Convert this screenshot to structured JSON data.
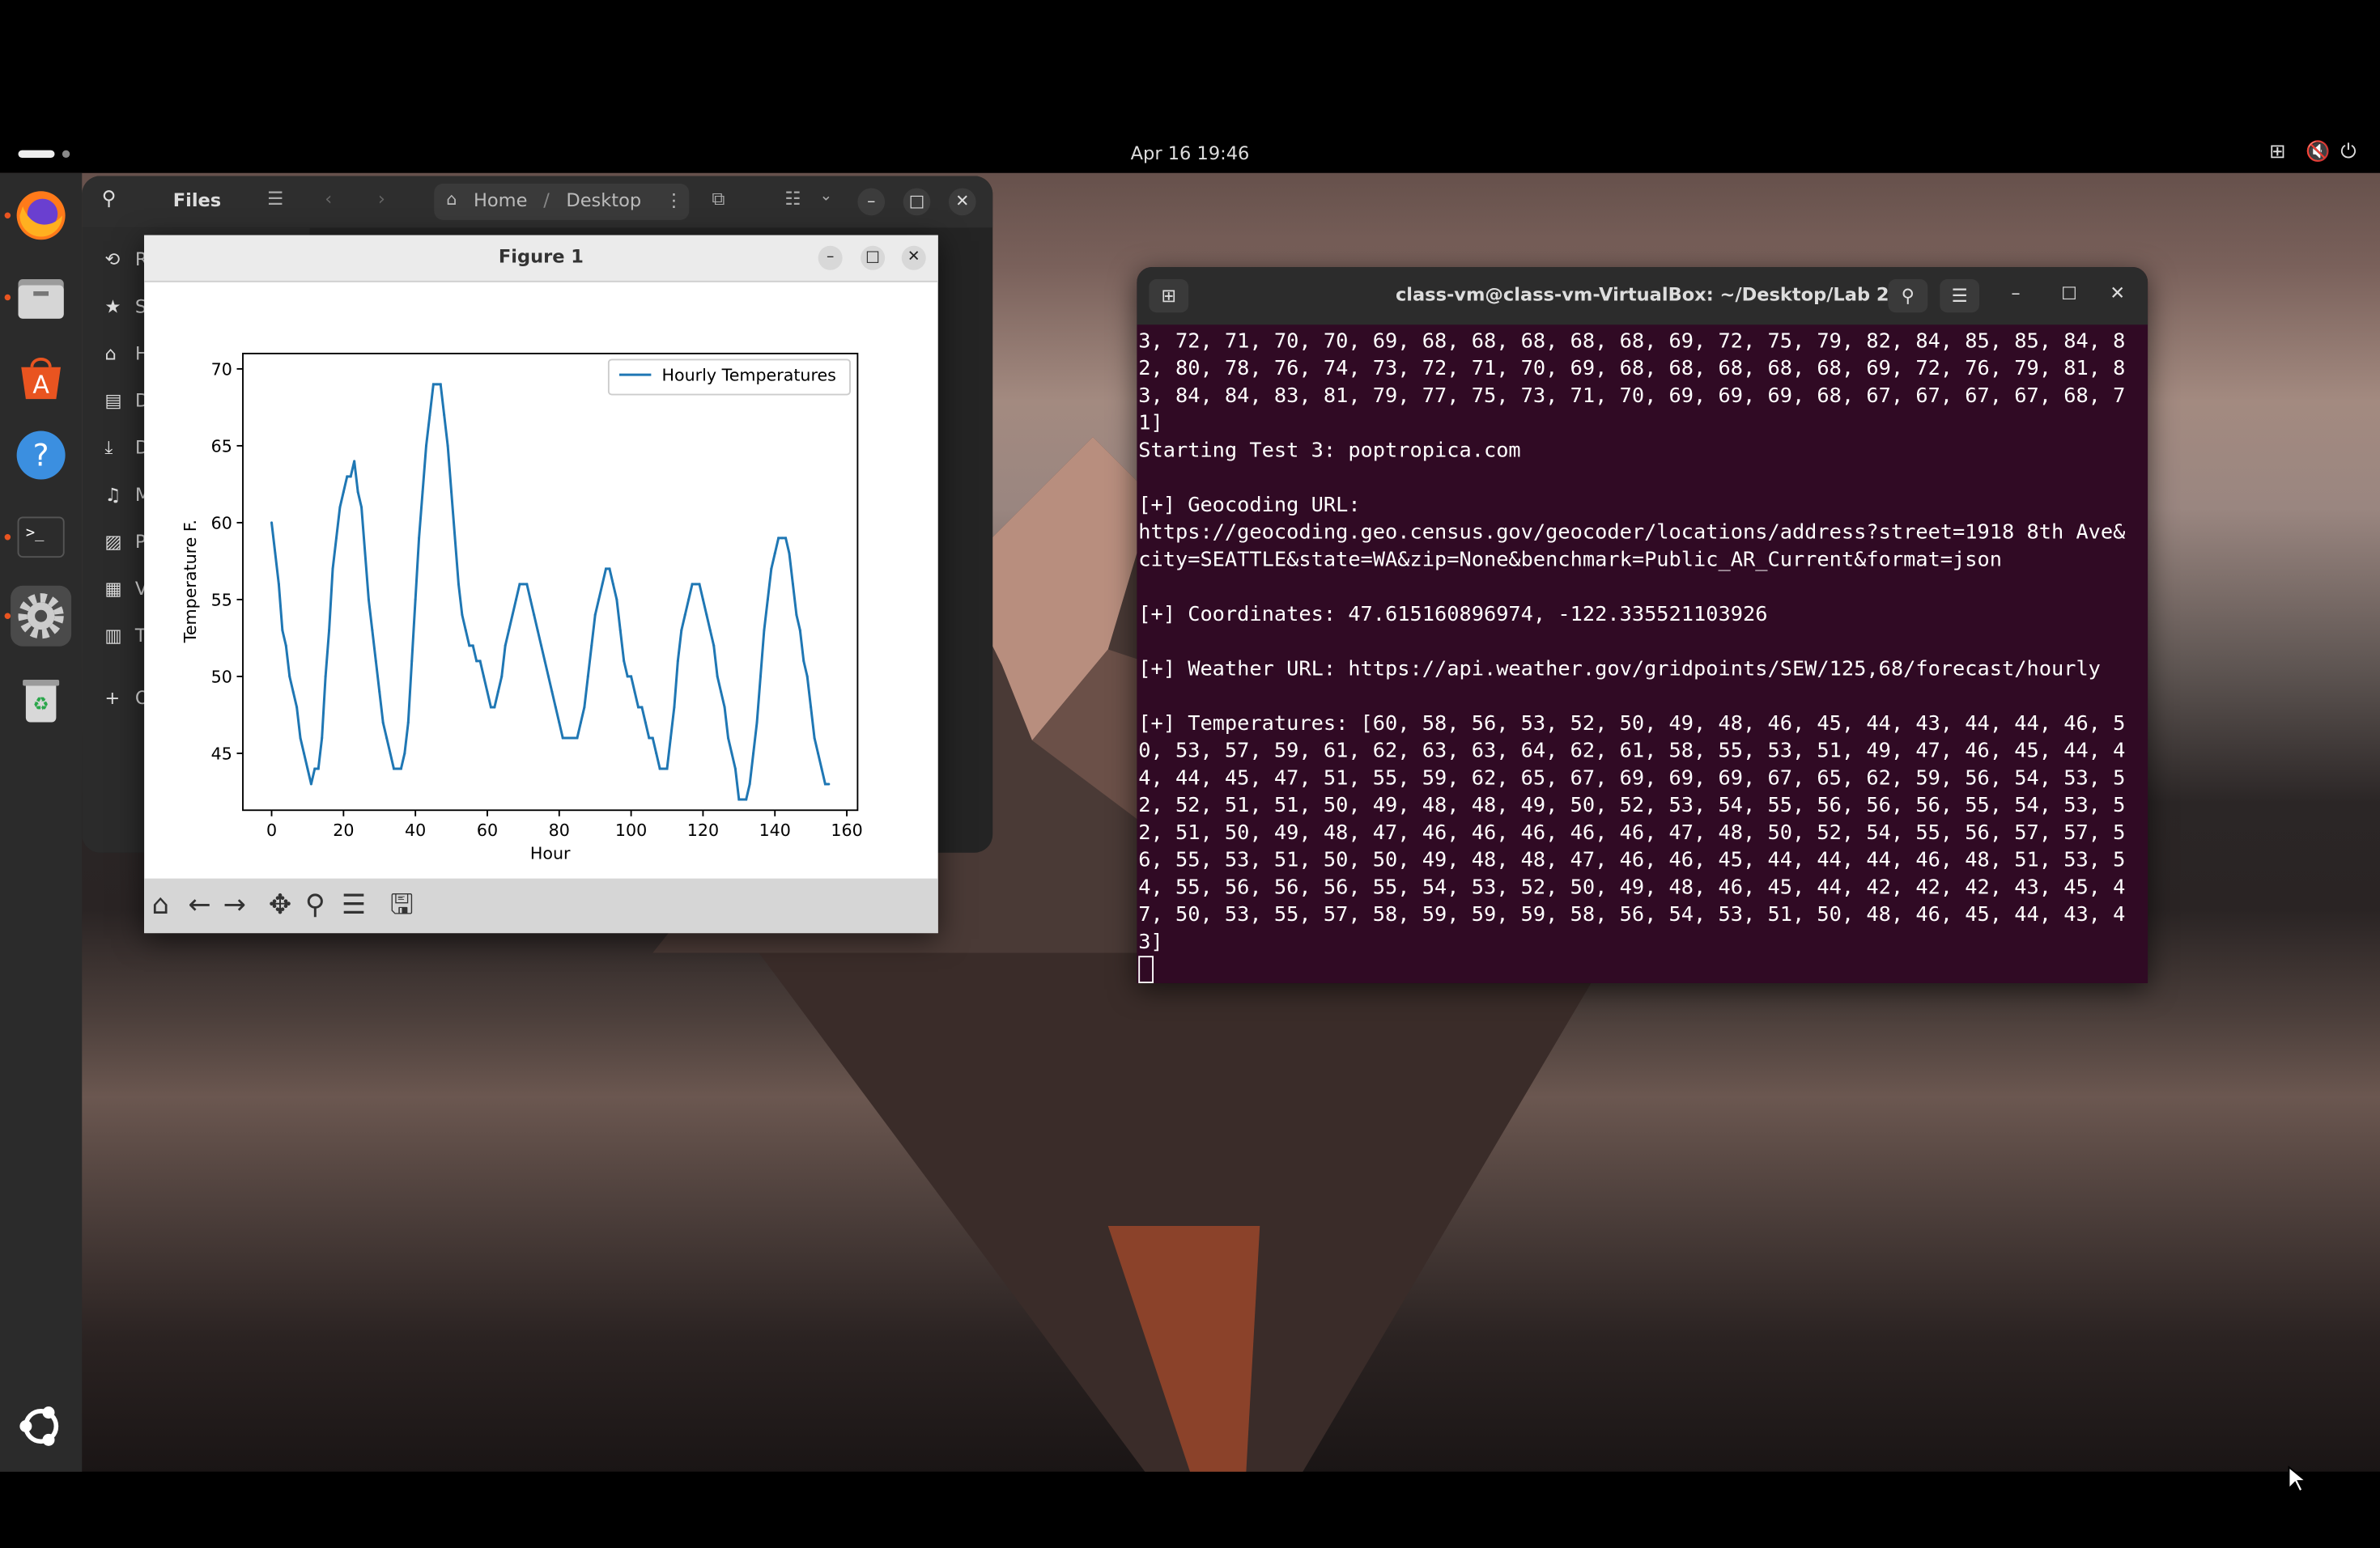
{
  "panel": {
    "clock": "Apr 16  19:46"
  },
  "dock": {
    "items": [
      "firefox-icon",
      "files-icon",
      "app-center-icon",
      "help-icon",
      "terminal-icon",
      "settings-icon",
      "trash-icon",
      "ubuntu-logo-icon"
    ]
  },
  "files": {
    "title": "Files",
    "breadcrumb": [
      "Home",
      "Desktop"
    ],
    "sidebar_fragments": [
      "R",
      "S",
      "H",
      "D",
      "D",
      "M",
      "P",
      "V",
      "T",
      "O"
    ]
  },
  "figure": {
    "window_title": "Figure 1",
    "toolbar": [
      "home-icon",
      "back-icon",
      "forward-icon",
      "pan-icon",
      "zoom-icon",
      "configure-icon",
      "save-icon"
    ]
  },
  "chart_data": {
    "type": "line",
    "xlabel": "Hour",
    "ylabel": "Temperature F.",
    "xlim": [
      -8,
      163
    ],
    "ylim": [
      41.3,
      71.0
    ],
    "xticks": [
      0,
      20,
      40,
      60,
      80,
      100,
      120,
      140,
      160
    ],
    "yticks": [
      45,
      50,
      55,
      60,
      65,
      70
    ],
    "legend": "top-right",
    "series": [
      {
        "name": "Hourly Temperatures",
        "color": "#1f77b4",
        "values": [
          60,
          58,
          56,
          53,
          52,
          50,
          49,
          48,
          46,
          45,
          44,
          43,
          44,
          44,
          46,
          50,
          53,
          57,
          59,
          61,
          62,
          63,
          63,
          64,
          62,
          61,
          58,
          55,
          53,
          51,
          49,
          47,
          46,
          45,
          44,
          44,
          44,
          45,
          47,
          51,
          55,
          59,
          62,
          65,
          67,
          69,
          69,
          69,
          67,
          65,
          62,
          59,
          56,
          54,
          53,
          52,
          52,
          51,
          51,
          50,
          49,
          48,
          48,
          49,
          50,
          52,
          53,
          54,
          55,
          56,
          56,
          56,
          55,
          54,
          53,
          52,
          51,
          50,
          49,
          48,
          47,
          46,
          46,
          46,
          46,
          46,
          47,
          48,
          50,
          52,
          54,
          55,
          56,
          57,
          57,
          56,
          55,
          53,
          51,
          50,
          50,
          49,
          48,
          48,
          47,
          46,
          46,
          45,
          44,
          44,
          44,
          46,
          48,
          51,
          53,
          54,
          55,
          56,
          56,
          56,
          55,
          54,
          53,
          52,
          50,
          49,
          48,
          46,
          45,
          44,
          42,
          42,
          42,
          43,
          45,
          47,
          50,
          53,
          55,
          57,
          58,
          59,
          59,
          59,
          58,
          56,
          54,
          53,
          51,
          50,
          48,
          46,
          45,
          44,
          43,
          43
        ]
      }
    ]
  },
  "terminal": {
    "title": "class-vm@class-vm-VirtualBox: ~/Desktop/Lab 2",
    "lines": [
      "3, 72, 71, 70, 70, 69, 68, 68, 68, 68, 68, 69, 72, 75, 79, 82, 84, 85, 85, 84, 8",
      "2, 80, 78, 76, 74, 73, 72, 71, 70, 69, 68, 68, 68, 68, 68, 69, 72, 76, 79, 81, 8",
      "3, 84, 84, 83, 81, 79, 77, 75, 73, 71, 70, 69, 69, 69, 68, 67, 67, 67, 67, 68, 7",
      "1]",
      "Starting Test 3: poptropica.com",
      "",
      "[+] Geocoding URL:",
      "https://geocoding.geo.census.gov/geocoder/locations/address?street=1918 8th Ave&",
      "city=SEATTLE&state=WA&zip=None&benchmark=Public_AR_Current&format=json",
      "",
      "[+] Coordinates: 47.615160896974, -122.335521103926",
      "",
      "[+] Weather URL: https://api.weather.gov/gridpoints/SEW/125,68/forecast/hourly",
      "",
      "[+] Temperatures: [60, 58, 56, 53, 52, 50, 49, 48, 46, 45, 44, 43, 44, 44, 46, 5",
      "0, 53, 57, 59, 61, 62, 63, 63, 64, 62, 61, 58, 55, 53, 51, 49, 47, 46, 45, 44, 4",
      "4, 44, 45, 47, 51, 55, 59, 62, 65, 67, 69, 69, 69, 67, 65, 62, 59, 56, 54, 53, 5",
      "2, 52, 51, 51, 50, 49, 48, 48, 49, 50, 52, 53, 54, 55, 56, 56, 56, 55, 54, 53, 5",
      "2, 51, 50, 49, 48, 47, 46, 46, 46, 46, 46, 47, 48, 50, 52, 54, 55, 56, 57, 57, 5",
      "6, 55, 53, 51, 50, 50, 49, 48, 48, 47, 46, 46, 45, 44, 44, 44, 46, 48, 51, 53, 5",
      "4, 55, 56, 56, 56, 55, 54, 53, 52, 50, 49, 48, 46, 45, 44, 42, 42, 42, 43, 45, 4",
      "7, 50, 53, 55, 57, 58, 59, 59, 59, 58, 56, 54, 53, 51, 50, 48, 46, 45, 44, 43, 4",
      "3]"
    ]
  }
}
